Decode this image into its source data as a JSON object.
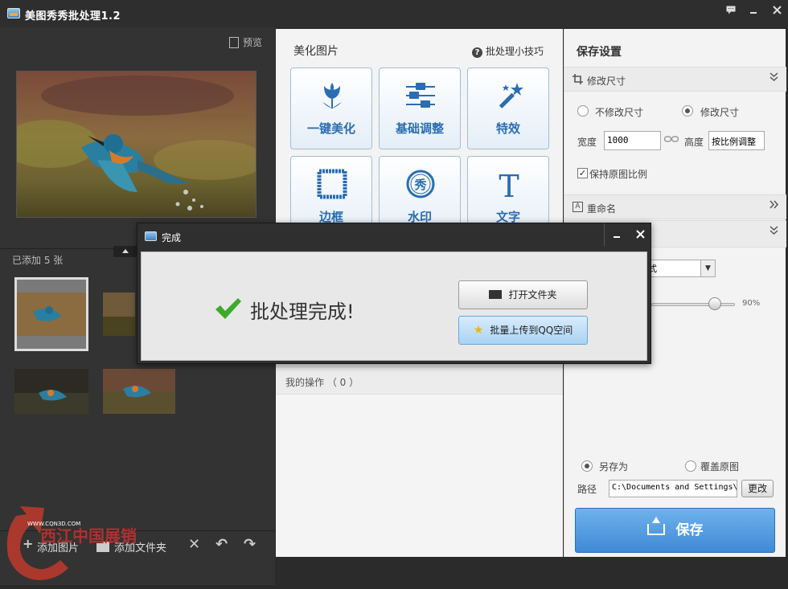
{
  "app": {
    "title": "美图秀秀批处理1.2"
  },
  "left": {
    "preview_label": "预览",
    "added_label": "已添加 5 张",
    "bottom": {
      "add_photos": "添加图片",
      "add_folder": "添加文件夹"
    }
  },
  "middle": {
    "title": "美化图片",
    "tips": "批处理小技巧",
    "tools": [
      "一键美化",
      "基础调整",
      "特效",
      "边框",
      "水印",
      "文字"
    ],
    "ops_label": "我的操作 （ 0 ）"
  },
  "right": {
    "title": "保存设置",
    "resize_section": "修改尺寸",
    "radio_no_resize": "不修改尺寸",
    "radio_resize": "修改尺寸",
    "width_label": "宽度",
    "width_value": "1000",
    "height_label": "高度",
    "height_value": "按比例调整",
    "keep_ratio": "保持原图比例",
    "rename_section": "重命名",
    "format_partial": "式",
    "quality_value": "90%",
    "save_as": "另存为",
    "overwrite": "覆盖原图",
    "path_label": "路径",
    "path_value": "C:\\Documents and Settings\\",
    "change_button": "更改",
    "save_button": "保存"
  },
  "dialog": {
    "title": "完成",
    "message": "批处理完成!",
    "open_folder": "打开文件夹",
    "upload_qq": "批量上传到QQ空间"
  },
  "watermark": {
    "text": "西江中国展销",
    "url": "WWW.CQN3D.COM"
  },
  "colors": {
    "accent": "#3f8ad6",
    "check": "#3daa2c",
    "tool_text": "#2a6db3"
  }
}
